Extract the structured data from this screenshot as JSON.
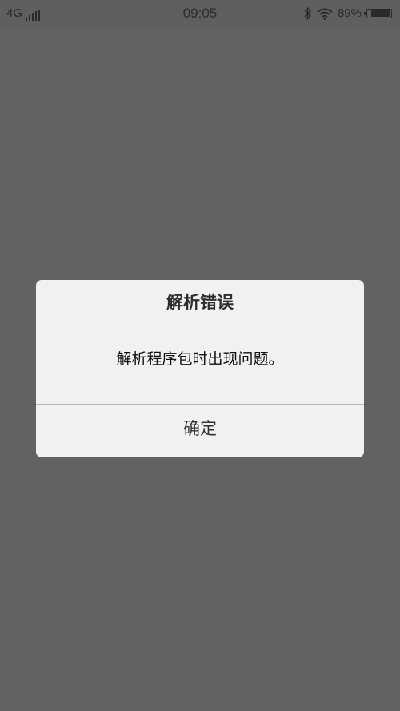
{
  "status_bar": {
    "network": "4G",
    "time": "09:05",
    "battery_percent": "89%",
    "battery_level": 0.89,
    "icons": [
      "signal-icon",
      "bluetooth-icon",
      "wifi-icon",
      "battery-icon"
    ]
  },
  "dialog": {
    "title": "解析错误",
    "message": "解析程序包时出现问题。",
    "confirm_label": "确定"
  },
  "colors": {
    "overlay": "#626262",
    "dialog_bg": "#f1f1f1",
    "divider": "#b8b8b8"
  }
}
